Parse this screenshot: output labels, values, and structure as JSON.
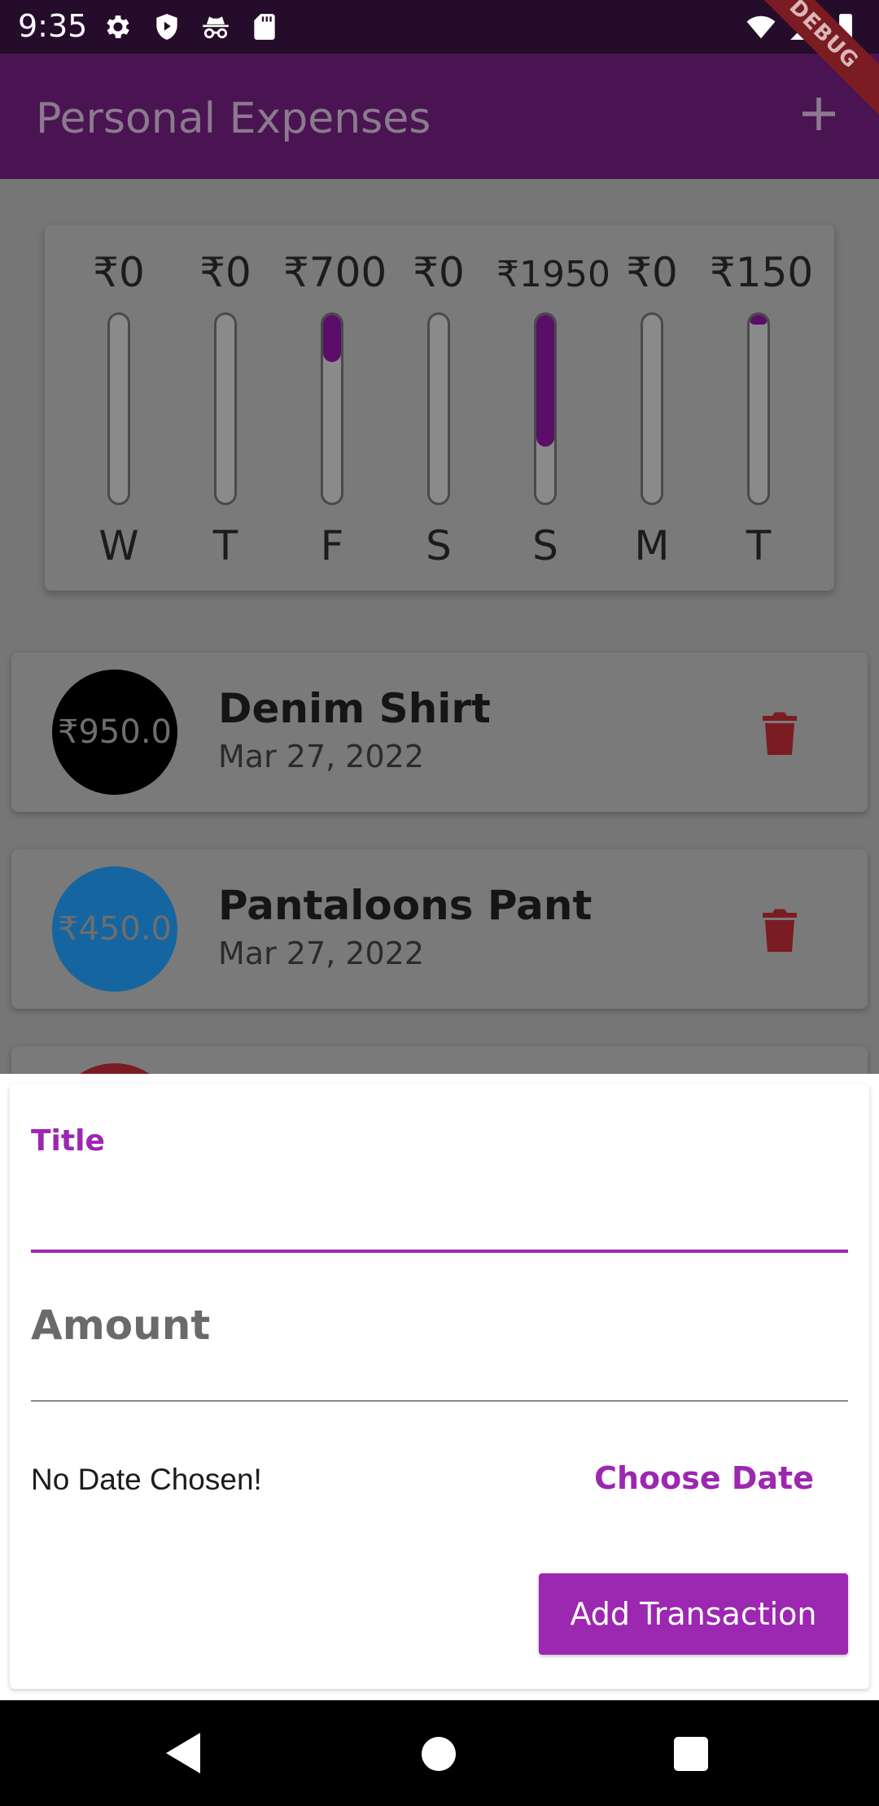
{
  "status_bar": {
    "time": "9:35",
    "left_icons": [
      "gear-icon",
      "shield-play-icon",
      "incognito-icon",
      "sd-card-icon"
    ],
    "right_icons": [
      "wifi-icon",
      "signal-icon",
      "battery-icon"
    ]
  },
  "app_bar": {
    "title": "Personal Expenses",
    "add_icon": "plus-icon"
  },
  "debug_banner": "DEBUG",
  "chart": {
    "bars": [
      {
        "amount": "₹0",
        "day": "W",
        "fill": 0.0
      },
      {
        "amount": "₹0",
        "day": "T",
        "fill": 0.0
      },
      {
        "amount": "₹700",
        "day": "F",
        "fill": 0.25
      },
      {
        "amount": "₹0",
        "day": "S",
        "fill": 0.0
      },
      {
        "amount": "₹1950",
        "day": "S",
        "fill": 0.7
      },
      {
        "amount": "₹0",
        "day": "M",
        "fill": 0.0
      },
      {
        "amount": "₹150",
        "day": "T",
        "fill": 0.05
      }
    ],
    "accent_color": "#9c27b0"
  },
  "transactions": [
    {
      "amount": "₹950.0",
      "title": "Denim Shirt",
      "date": "Mar 27, 2022",
      "avatar_color": "#000000"
    },
    {
      "amount": "₹450.0",
      "title": "Pantaloons Pant",
      "date": "Mar 27, 2022",
      "avatar_color": "#1565a0"
    }
  ],
  "form": {
    "title_label": "Title",
    "title_value": "",
    "amount_label": "Amount",
    "amount_value": "",
    "date_status": "No Date Chosen!",
    "choose_date_label": "Choose Date",
    "submit_label": "Add Transaction"
  }
}
